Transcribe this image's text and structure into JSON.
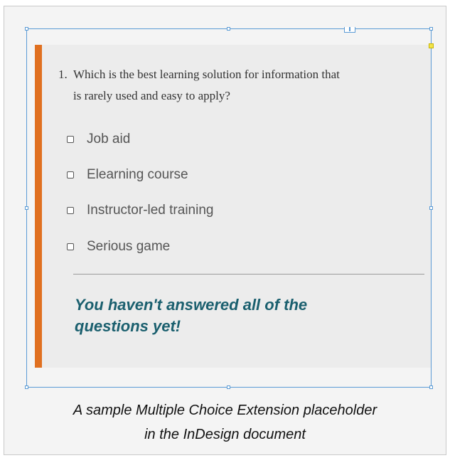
{
  "question": {
    "number": "1.",
    "line1": "Which is the best learning solution for information that",
    "line2": "is rarely used and easy to apply?"
  },
  "options": [
    {
      "label": "Job aid",
      "checked": false
    },
    {
      "label": "Elearning course",
      "checked": false
    },
    {
      "label": "Instructor-led training",
      "checked": false
    },
    {
      "label": "Serious game",
      "checked": false
    }
  ],
  "feedback": {
    "line1": "You haven't answered all of the",
    "line2": "questions yet!"
  },
  "caption": {
    "line1": "A sample Multiple Choice Extension placeholder",
    "line2": "in the InDesign document"
  },
  "colors": {
    "accent": "#e07020",
    "feedback_text": "#1a5f6e",
    "selection_frame": "#5b9bd5"
  },
  "icons": {
    "checkbox": "empty-checkbox-icon",
    "anchor": "anchored-object-icon"
  }
}
